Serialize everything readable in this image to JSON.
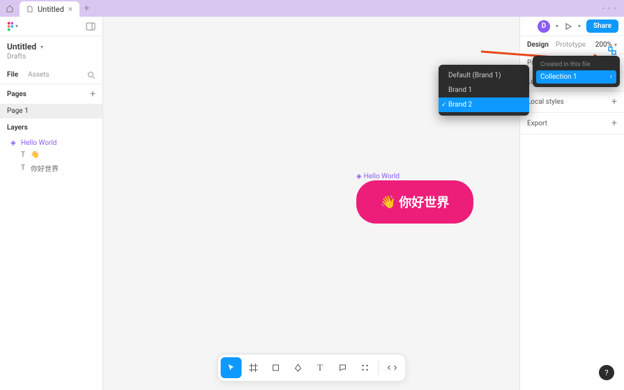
{
  "titlebar": {
    "tab_name": "Untitled"
  },
  "sidebar": {
    "doc_name": "Untitled",
    "subtitle": "Drafts",
    "tabs": {
      "file": "File",
      "assets": "Assets"
    },
    "pages_label": "Pages",
    "page1": "Page 1",
    "layers_label": "Layers",
    "frame_name": "Hello World",
    "child1": "👋",
    "child2": "你好世界"
  },
  "canvas": {
    "frame_label": "Hello World",
    "emoji": "👋",
    "text": "你好世界"
  },
  "right": {
    "avatar_letter": "D",
    "share": "Share",
    "tabs": {
      "design": "Design",
      "prototype": "Prototype"
    },
    "zoom": "200%",
    "page": "Page",
    "local_vars": "Local variables",
    "local_styles": "Local styles",
    "export": "Export"
  },
  "brand_dropdown": {
    "default": "Default (Brand 1)",
    "b1": "Brand 1",
    "b2": "Brand 2"
  },
  "collection_dropdown": {
    "header": "Created in this file",
    "item": "Collection 1"
  },
  "help": "?"
}
